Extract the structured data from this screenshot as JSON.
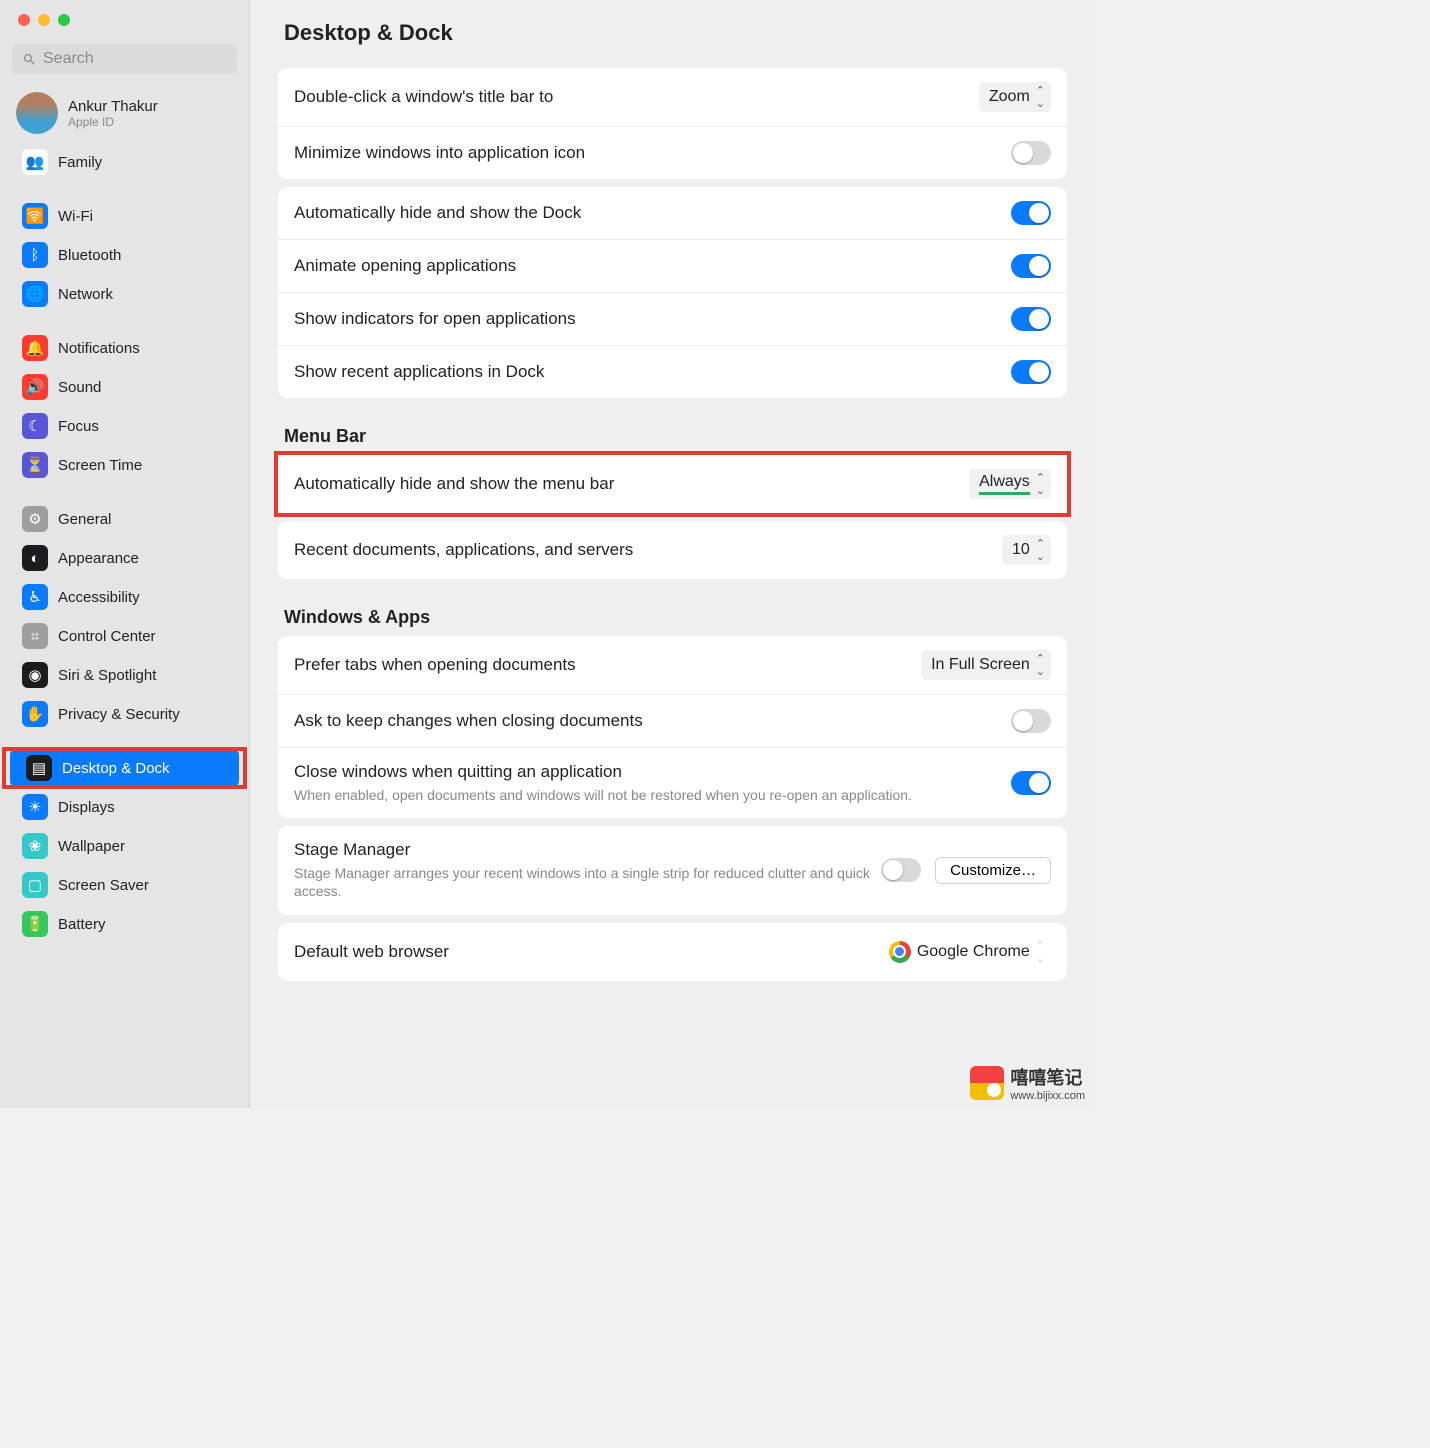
{
  "window": {
    "title": "Desktop & Dock"
  },
  "search": {
    "placeholder": "Search"
  },
  "account": {
    "name": "Ankur Thakur",
    "subtitle": "Apple ID"
  },
  "sidebar": {
    "items": [
      {
        "label": "Family",
        "icon": "family-icon",
        "color": "#ffffff"
      },
      {
        "label": "Wi-Fi",
        "icon": "wifi-icon",
        "color": "#0a7aff"
      },
      {
        "label": "Bluetooth",
        "icon": "bluetooth-icon",
        "color": "#0a7aff"
      },
      {
        "label": "Network",
        "icon": "network-icon",
        "color": "#0a7aff"
      },
      {
        "label": "Notifications",
        "icon": "notifications-icon",
        "color": "#ff3b30"
      },
      {
        "label": "Sound",
        "icon": "sound-icon",
        "color": "#ff3b30"
      },
      {
        "label": "Focus",
        "icon": "focus-icon",
        "color": "#5856d6"
      },
      {
        "label": "Screen Time",
        "icon": "screentime-icon",
        "color": "#5856d6"
      },
      {
        "label": "General",
        "icon": "general-icon",
        "color": "#9e9e9e"
      },
      {
        "label": "Appearance",
        "icon": "appearance-icon",
        "color": "#1c1c1e"
      },
      {
        "label": "Accessibility",
        "icon": "accessibility-icon",
        "color": "#0a7aff"
      },
      {
        "label": "Control Center",
        "icon": "controlcenter-icon",
        "color": "#9e9e9e"
      },
      {
        "label": "Siri & Spotlight",
        "icon": "siri-icon",
        "color": "#1c1c1e"
      },
      {
        "label": "Privacy & Security",
        "icon": "privacy-icon",
        "color": "#0a7aff"
      },
      {
        "label": "Desktop & Dock",
        "icon": "desktopdock-icon",
        "color": "#1c1c1e",
        "selected": true
      },
      {
        "label": "Displays",
        "icon": "displays-icon",
        "color": "#0a7aff"
      },
      {
        "label": "Wallpaper",
        "icon": "wallpaper-icon",
        "color": "#34c8c8"
      },
      {
        "label": "Screen Saver",
        "icon": "screensaver-icon",
        "color": "#34c8c8"
      },
      {
        "label": "Battery",
        "icon": "battery-icon",
        "color": "#34c759"
      }
    ]
  },
  "groups": {
    "titlebar": {
      "rows": [
        {
          "label": "Double-click a window's title bar to",
          "control": "popup",
          "value": "Zoom"
        },
        {
          "label": "Minimize windows into application icon",
          "control": "toggle",
          "state": "off"
        }
      ]
    },
    "dock": {
      "rows": [
        {
          "label": "Automatically hide and show the Dock",
          "control": "toggle",
          "state": "on"
        },
        {
          "label": "Animate opening applications",
          "control": "toggle",
          "state": "on"
        },
        {
          "label": "Show indicators for open applications",
          "control": "toggle",
          "state": "on"
        },
        {
          "label": "Show recent applications in Dock",
          "control": "toggle",
          "state": "on"
        }
      ]
    },
    "menubar": {
      "heading": "Menu Bar",
      "highlighted": {
        "label": "Automatically hide and show the menu bar",
        "control": "popup",
        "value": "Always"
      },
      "rows": [
        {
          "label": "Recent documents, applications, and servers",
          "control": "popup",
          "value": "10"
        }
      ]
    },
    "windows": {
      "heading": "Windows & Apps",
      "rows": [
        {
          "label": "Prefer tabs when opening documents",
          "control": "popup",
          "value": "In Full Screen"
        },
        {
          "label": "Ask to keep changes when closing documents",
          "control": "toggle",
          "state": "off"
        },
        {
          "label": "Close windows when quitting an application",
          "control": "toggle",
          "state": "on",
          "sub": "When enabled, open documents and windows will not be restored when you re-open an application."
        }
      ]
    },
    "stage": {
      "label": "Stage Manager",
      "sub": "Stage Manager arranges your recent windows into a single strip for reduced clutter and quick access.",
      "button": "Customize…",
      "state": "off"
    },
    "browser": {
      "label": "Default web browser",
      "value": "Google Chrome"
    }
  },
  "watermark": {
    "cn": "嘻嘻笔记",
    "url": "www.bijixx.com"
  }
}
